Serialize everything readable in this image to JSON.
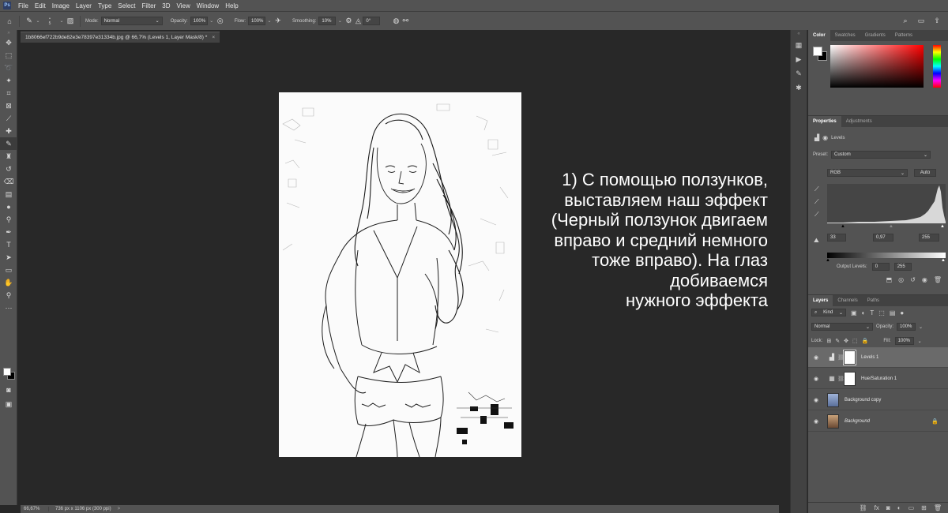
{
  "menu": [
    "File",
    "Edit",
    "Image",
    "Layer",
    "Type",
    "Select",
    "Filter",
    "3D",
    "View",
    "Window",
    "Help"
  ],
  "logo": "Ps",
  "options": {
    "brush_size": "5",
    "mode_label": "Mode:",
    "mode_value": "Normal",
    "opacity_label": "Opacity:",
    "opacity_value": "100%",
    "flow_label": "Flow:",
    "flow_value": "100%",
    "smoothing_label": "Smoothing:",
    "smoothing_value": "10%",
    "angle_value": "0°"
  },
  "document": {
    "tab_title": "1b8066ef722b9de82e3e78397e31334b.jpg @ 66,7% (Levels 1, Layer Mask/8) *",
    "close": "×"
  },
  "overlay_text": "1) С помощью ползунков,\nвыставляем наш эффект\n(Черный ползунок двигаем\nвправо и средний немного \nтоже вправо). На глаз \nдобиваемся\nнужного эффекта",
  "status": {
    "zoom": "66,67%",
    "info": "736 px x 1106 px (300 ppi)",
    "arrow": ">"
  },
  "color_panel": {
    "tabs": [
      "Color",
      "Swatches",
      "Gradients",
      "Patterns"
    ],
    "active_tab": "Color"
  },
  "properties": {
    "tabs": [
      "Properties",
      "Adjustments"
    ],
    "title": "Levels",
    "preset_label": "Preset:",
    "preset_value": "Custom",
    "channel": "RGB",
    "auto": "Auto",
    "input_black": "33",
    "input_gamma": "0,97",
    "input_white": "255",
    "output_label": "Output Levels:",
    "output_black": "0",
    "output_white": "255"
  },
  "layers_panel": {
    "tabs": [
      "Layers",
      "Channels",
      "Paths"
    ],
    "kind_label": "Kind",
    "blend_mode": "Normal",
    "opacity_label": "Opacity:",
    "opacity_value": "100%",
    "lock_label": "Lock:",
    "fill_label": "Fill:",
    "fill_value": "100%",
    "layers": [
      {
        "name": "Levels 1",
        "selected": true,
        "type": "levels"
      },
      {
        "name": "Hue/Saturation 1",
        "selected": false,
        "type": "hue"
      },
      {
        "name": "Background copy",
        "selected": false,
        "type": "image"
      },
      {
        "name": "Background",
        "selected": false,
        "type": "background",
        "locked": true
      }
    ]
  },
  "colors": {
    "canvas_bg": "#282828",
    "panel_bg": "#535353",
    "selected_layer": "#6a6a6a"
  }
}
